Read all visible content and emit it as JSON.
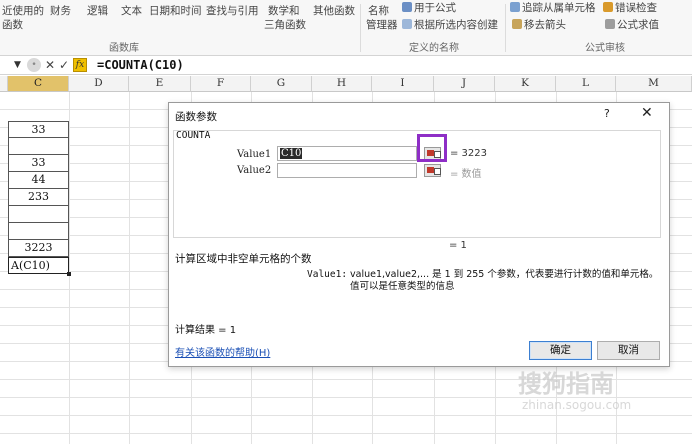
{
  "ribbon": {
    "items": [
      {
        "label": "近使用的"
      },
      {
        "label": "财务"
      },
      {
        "label": "逻辑"
      },
      {
        "label": "文本"
      },
      {
        "label": "日期和时间"
      },
      {
        "label": "查找与引用"
      },
      {
        "label": "数学和"
      },
      {
        "label": "其他函数"
      },
      {
        "label": "名称"
      },
      {
        "label": "用于公式"
      },
      {
        "label": "追踪从属单元格"
      },
      {
        "label": "错误检查"
      }
    ],
    "row2": [
      {
        "label": "函数"
      },
      {
        "label": "三角函数"
      },
      {
        "label": "管理器"
      },
      {
        "label": "根据所选内容创建"
      },
      {
        "label": "移去箭头"
      },
      {
        "label": "公式求值"
      }
    ],
    "groups": {
      "function_library": "函数库",
      "defined_names": "定义的名称",
      "formula_auditing": "公式审核"
    },
    "icons": {
      "define_name": "pen-icon",
      "create_from_selection": "table-icon",
      "trace_dependents": "arrow-icon",
      "error_check": "warning-icon",
      "evaluate": "evaluate-icon"
    }
  },
  "formula_bar": {
    "formula": "=COUNTA(C10)",
    "fx_label": "fx",
    "cancel_symbol": "✕",
    "enter_symbol": "✓"
  },
  "columns": [
    "C",
    "D",
    "E",
    "F",
    "G",
    "H",
    "I",
    "J",
    "K",
    "L",
    "M"
  ],
  "selected_column": "C",
  "cells": [
    {
      "row": 2,
      "value": "33"
    },
    {
      "row": 3,
      "value": ""
    },
    {
      "row": 4,
      "value": "33"
    },
    {
      "row": 5,
      "value": "44"
    },
    {
      "row": 6,
      "value": "233"
    },
    {
      "row": 7,
      "value": ""
    },
    {
      "row": 8,
      "value": ""
    },
    {
      "row": 9,
      "value": "3223"
    },
    {
      "row": 10,
      "value": "A(C10)"
    }
  ],
  "dialog": {
    "title": "函数参数",
    "help_symbol": "?",
    "close_symbol": "✕",
    "function_name": "COUNTA",
    "args": [
      {
        "label": "Value1",
        "value": "C10",
        "result": "= 3223"
      },
      {
        "label": "Value2",
        "value": "",
        "result": "= 数值"
      }
    ],
    "total_result": "= 1",
    "description": "计算区域中非空单元格的个数",
    "arg_desc_label": "Value1:",
    "arg_desc_text": "value1,value2,... 是 1 到 255 个参数，代表要进行计数的值和单元格。值可以是任意类型的信息",
    "calc_result": "计算结果 = 1",
    "help_link": "有关该函数的帮助(H)",
    "ok": "确定",
    "cancel": "取消"
  },
  "watermark": {
    "text": "搜狗指南",
    "url": "zhinan.sogou.com"
  },
  "colors": {
    "selected_header": "#e2c26a",
    "highlight_border": "#8e2ec6",
    "link": "#1a4fb5"
  }
}
